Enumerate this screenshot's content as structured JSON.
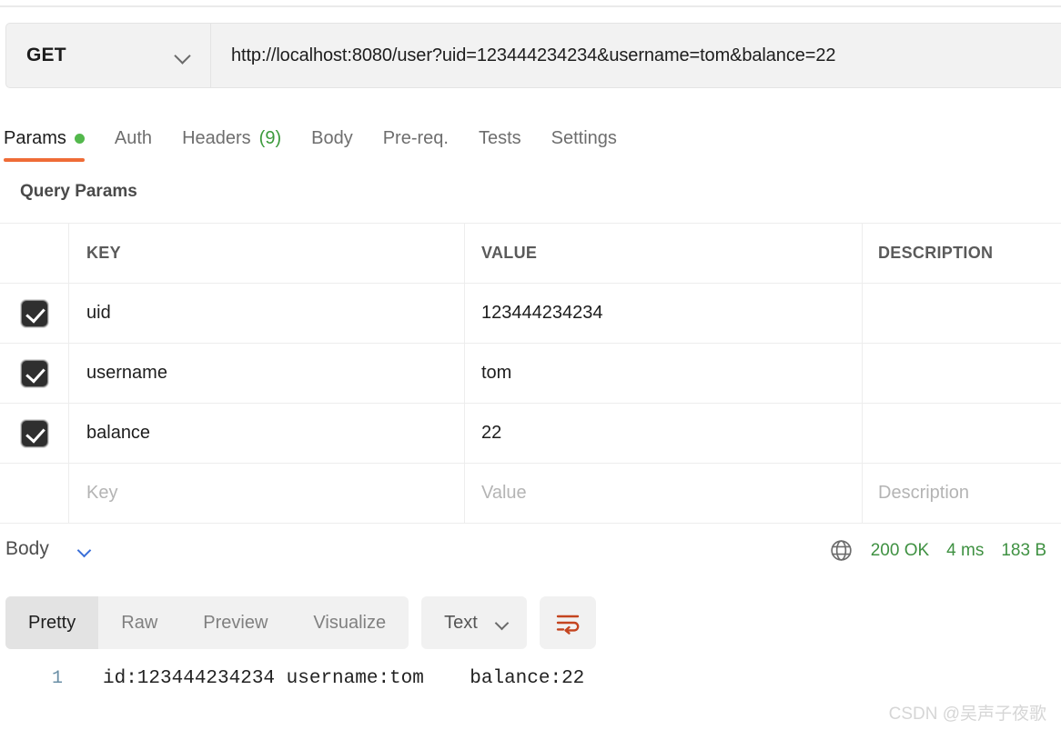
{
  "request": {
    "method": "GET",
    "method_icon": "chevron-down-icon",
    "url": "http://localhost:8080/user?uid=123444234234&username=tom&balance=22"
  },
  "request_tabs": [
    {
      "label": "Params",
      "badge": "",
      "dot": true,
      "active": true
    },
    {
      "label": "Auth",
      "badge": "",
      "dot": false,
      "active": false
    },
    {
      "label": "Headers",
      "badge": "(9)",
      "dot": false,
      "active": false
    },
    {
      "label": "Body",
      "badge": "",
      "dot": false,
      "active": false
    },
    {
      "label": "Pre-req.",
      "badge": "",
      "dot": false,
      "active": false
    },
    {
      "label": "Tests",
      "badge": "",
      "dot": false,
      "active": false
    },
    {
      "label": "Settings",
      "badge": "",
      "dot": false,
      "active": false
    }
  ],
  "query_params": {
    "title": "Query Params",
    "columns": {
      "key": "KEY",
      "value": "VALUE",
      "description": "DESCRIPTION"
    },
    "rows": [
      {
        "checked": true,
        "key": "uid",
        "value": "123444234234",
        "description": ""
      },
      {
        "checked": true,
        "key": "username",
        "value": "tom",
        "description": ""
      },
      {
        "checked": true,
        "key": "balance",
        "value": "22",
        "description": ""
      }
    ],
    "new_row": {
      "key_placeholder": "Key",
      "value_placeholder": "Value",
      "description_placeholder": "Description"
    }
  },
  "response": {
    "body_label": "Body",
    "collapse_icon": "chevron-down-icon",
    "network_icon": "globe-icon",
    "status": "200 OK",
    "time": "4 ms",
    "size": "183 B",
    "view_tabs": [
      {
        "label": "Pretty",
        "active": true
      },
      {
        "label": "Raw",
        "active": false
      },
      {
        "label": "Preview",
        "active": false
      },
      {
        "label": "Visualize",
        "active": false
      }
    ],
    "format": "Text",
    "format_icon": "chevron-down-icon",
    "wrap_icon": "word-wrap-icon",
    "lines": [
      {
        "number": "1",
        "text": "id:123444234234 username:tom    balance:22"
      }
    ]
  },
  "watermark": "CSDN @吴声子夜歌",
  "colors": {
    "accent_orange": "#ef6c37",
    "status_green": "#3f9142",
    "dot_green": "#53b84c",
    "wrap_orange": "#c4441f",
    "chevron_blue": "#3a6fd8",
    "checkbox_dark": "#2f2f2f"
  }
}
